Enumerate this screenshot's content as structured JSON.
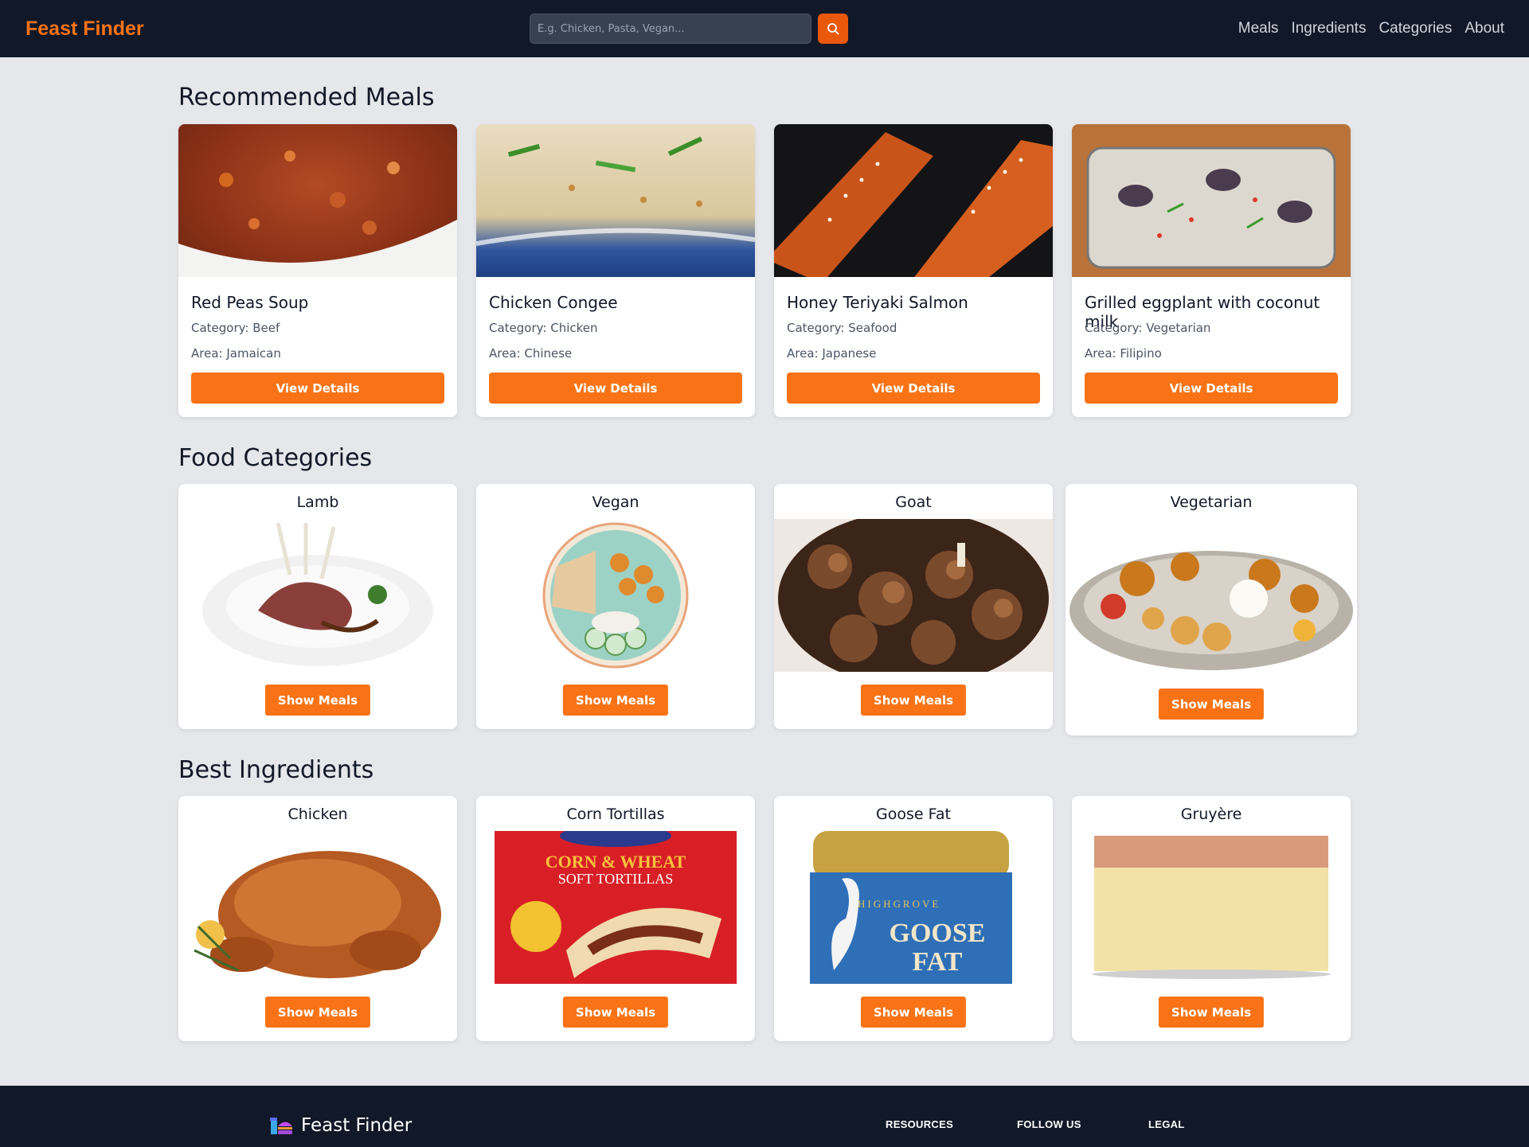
{
  "nav": {
    "brand": "Feast Finder",
    "search_placeholder": "E.g. Chicken, Pasta, Vegan...",
    "links": [
      "Meals",
      "Ingredients",
      "Categories",
      "About"
    ]
  },
  "recommended": {
    "title": "Recommended Meals",
    "button_label": "View Details",
    "meals": [
      {
        "name": "Red Peas Soup",
        "category": "Category: Beef",
        "area": "Area: Jamaican"
      },
      {
        "name": "Chicken Congee",
        "category": "Category: Chicken",
        "area": "Area: Chinese"
      },
      {
        "name": "Honey Teriyaki Salmon",
        "category": "Category: Seafood",
        "area": "Area: Japanese"
      },
      {
        "name": "Grilled eggplant with coconut milk",
        "category": "Category: Vegetarian",
        "area": "Area: Filipino"
      }
    ]
  },
  "categories": {
    "title": "Food Categories",
    "button_label": "Show Meals",
    "items": [
      "Lamb",
      "Vegan",
      "Goat",
      "Vegetarian"
    ]
  },
  "ingredients": {
    "title": "Best Ingredients",
    "button_label": "Show Meals",
    "items": [
      "Chicken",
      "Corn Tortillas",
      "Goose Fat",
      "Gruyère"
    ],
    "package_text": {
      "tortilla_line1": "CORN & WHEAT",
      "tortilla_line2": "SOFT TORTILLAS",
      "goose_brand": "HIGHGROVE",
      "goose_line1": "GOOSE",
      "goose_line2": "FAT"
    }
  },
  "footer": {
    "brand": "Feast Finder",
    "headings": [
      "RESOURCES",
      "FOLLOW US",
      "LEGAL"
    ]
  },
  "colors": {
    "accent": "#f97316",
    "nav_bg": "#111827",
    "page_bg": "#e5e7eb"
  }
}
